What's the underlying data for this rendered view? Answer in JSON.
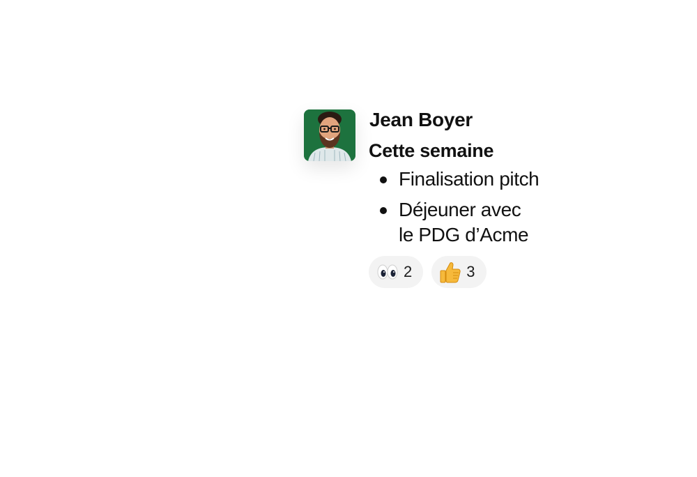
{
  "message": {
    "author": "Jean Boyer",
    "heading": "Cette semaine",
    "items": [
      {
        "line1": "Finalisation pitch",
        "line2": ""
      },
      {
        "line1": "Déjeuner avec",
        "line2": "le PDG d’Acme"
      }
    ],
    "reactions": [
      {
        "icon": "eyes-emoji-icon",
        "count": "2"
      },
      {
        "icon": "thumbs-up-emoji-icon",
        "count": "3"
      }
    ]
  }
}
